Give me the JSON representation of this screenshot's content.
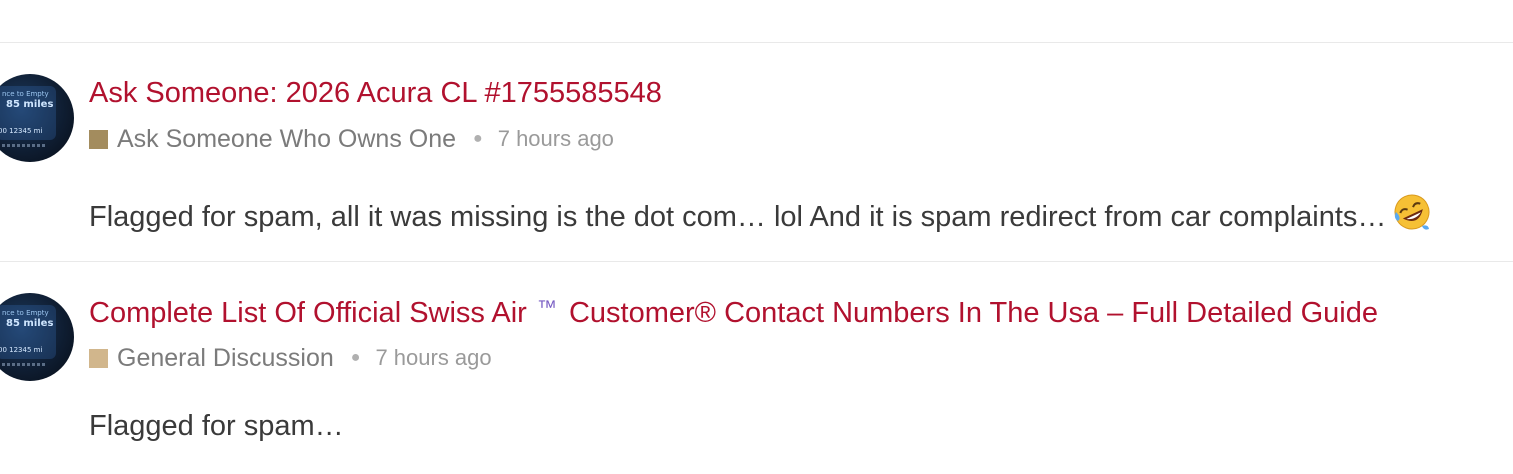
{
  "topics": [
    {
      "title": "Ask Someone: 2026 Acura CL #1755585548",
      "category": "Ask Someone Who Owns One",
      "category_color": "#a38c5e",
      "time": "7 hours ago",
      "excerpt": "Flagged for spam, all it was missing is the dot com… lol And it is spam redirect from car complaints…",
      "emoji": "rolling-on-the-floor-laughing"
    },
    {
      "title_before": "Complete List Of Official Swiss Air",
      "title_tm": "™",
      "title_after": "Customer® Contact Numbers In The Usa – Full Detailed Guide",
      "category": "General Discussion",
      "category_color": "#d1b68c",
      "time": "7 hours ago",
      "excerpt": "Flagged for spam…"
    }
  ],
  "avatar_text": {
    "line1": "nce to Empty",
    "line2": "85 miles",
    "line3": "00   12345 mi"
  },
  "colors": {
    "title": "#b1112e",
    "meta": "#7b7b7b",
    "excerpt": "#3a3a3a",
    "divider": "#e9e9e9"
  }
}
